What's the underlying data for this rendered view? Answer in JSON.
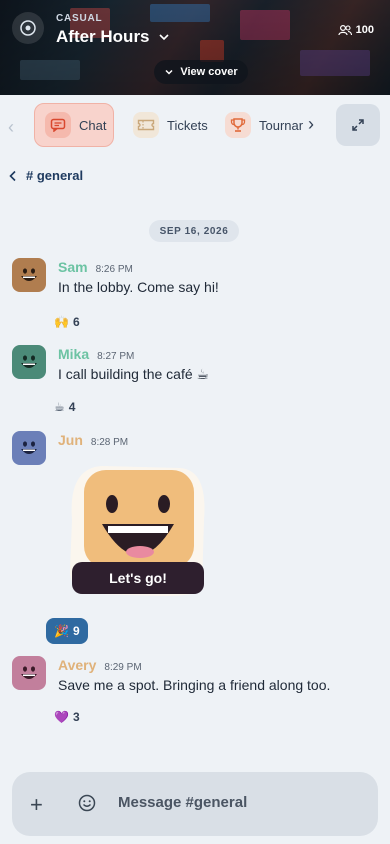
{
  "header": {
    "kicker": "CASUAL",
    "title": "After Hours",
    "member_count": "100",
    "view_cover_label": "View cover"
  },
  "tabs": [
    {
      "label": "Chat",
      "icon": "chat-icon",
      "active": true
    },
    {
      "label": "Tickets",
      "icon": "ticket-icon",
      "active": false
    },
    {
      "label": "Tournar",
      "icon": "trophy-icon",
      "active": false
    }
  ],
  "channel": {
    "name": "# general"
  },
  "date_divider": "SEP 16, 2026",
  "messages": [
    {
      "author": "Sam",
      "time": "8:26 PM",
      "text": "In the lobby. Come say hi!",
      "reaction": {
        "emoji": "🙌",
        "count": "6"
      },
      "author_color": "#6cc3a3",
      "avatar_color": "#b07d4f"
    },
    {
      "author": "Mika",
      "time": "8:27 PM",
      "text": "I call building the café ☕",
      "reaction": {
        "emoji": "☕",
        "count": "4"
      },
      "author_color": "#6cc3a3",
      "avatar_color": "#4b8a78"
    },
    {
      "author": "Jun",
      "time": "8:28 PM",
      "sticker_caption": "Let's go!",
      "reaction": {
        "emoji": "🎉",
        "count": "9"
      },
      "author_color": "#e0b27a",
      "avatar_color": "#6b7fb8"
    },
    {
      "author": "Avery",
      "time": "8:29 PM",
      "text": "Save me a spot. Bringing a friend along too.",
      "reaction": {
        "emoji": "💜",
        "count": "3"
      },
      "author_color": "#e0b27a",
      "avatar_color": "#c27f9c"
    }
  ],
  "composer": {
    "placeholder": "Message #general"
  },
  "colors": {
    "accent": "#2f6aa1",
    "active_tab": "#f8d3cc",
    "background": "#eef2f6"
  }
}
